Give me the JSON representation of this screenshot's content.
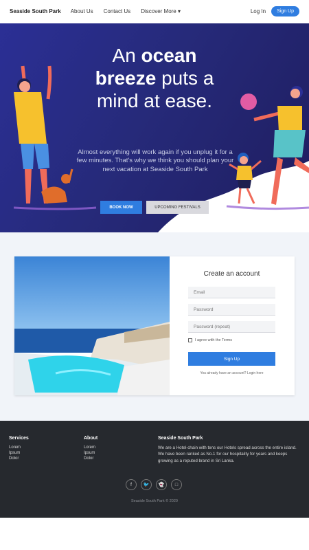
{
  "nav": {
    "brand": "Seaside South Park",
    "links": [
      "About Us",
      "Contact Us",
      "Discover More ▾"
    ],
    "login": "Log In",
    "signup": "Sign Up"
  },
  "hero": {
    "headline_1": "An",
    "headline_2": "ocean",
    "headline_3": "breeze",
    "headline_4": "puts a",
    "headline_5": "mind at ease.",
    "subtitle": "Almost everything will work again if you unplug it for a few minutes. That's why we think you should plan your next vacation at Seaside South Park",
    "book_now": "BOOK NOW",
    "upcoming": "UPCOMING FESTIVALS"
  },
  "signup_card": {
    "title": "Create an account",
    "email_placeholder": "Email",
    "password_placeholder": "Password",
    "password_repeat_placeholder": "Password (repeat)",
    "terms": "I agree with the Terms",
    "button": "Sign Up",
    "already": "You already have an account? Login here"
  },
  "footer": {
    "services_title": "Services",
    "services_items": [
      "Lorem",
      "Ipsum",
      "Dolor"
    ],
    "about_title": "About",
    "about_items": [
      "Lorem",
      "Ipsum",
      "Dolor"
    ],
    "park_title": "Seaside South Park",
    "park_text": "We are a Hotel-chain with tens our Hotels spread across the entire island. We have been ranked as No.1 for our hospitality for years and keeps growing as a reputed brand in Sri Lanka.",
    "social_icons": [
      "facebook-icon",
      "twitter-icon",
      "snapchat-icon",
      "instagram-icon"
    ],
    "copyright": "Seaside South Park © 2020"
  },
  "colors": {
    "accent": "#2f7de0",
    "hero_bg": "#262a7a",
    "footer_bg": "#26292e",
    "section_bg": "#f1f4f9"
  }
}
